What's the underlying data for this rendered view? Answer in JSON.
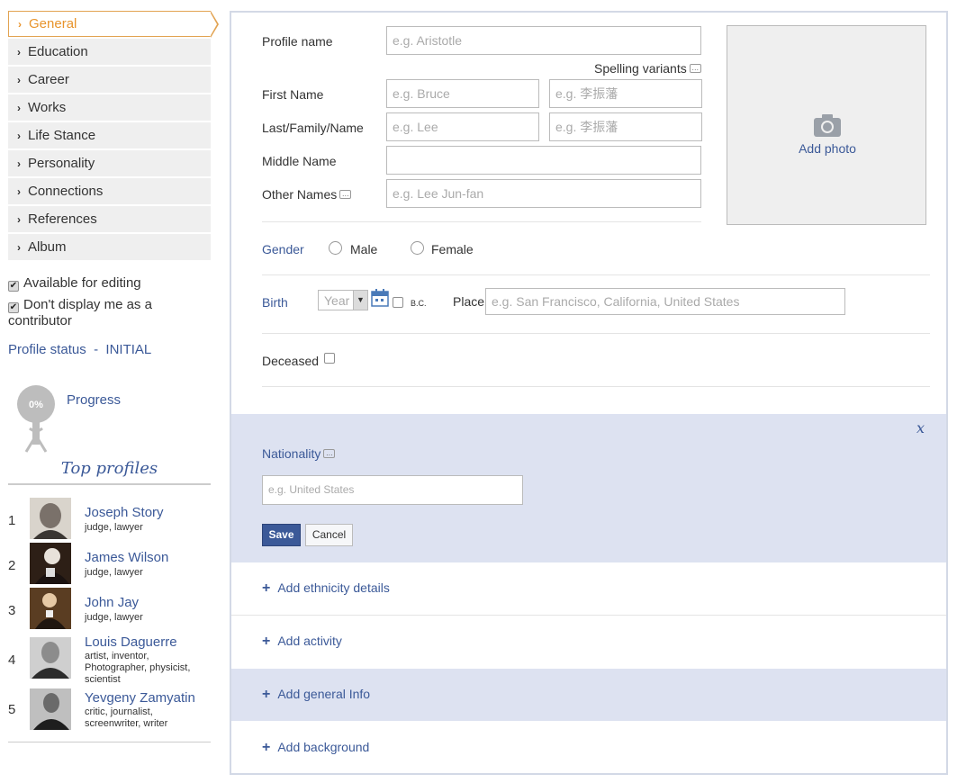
{
  "sidebar": {
    "items": [
      {
        "label": "General"
      },
      {
        "label": "Education"
      },
      {
        "label": "Career"
      },
      {
        "label": "Works"
      },
      {
        "label": "Life Stance"
      },
      {
        "label": "Personality"
      },
      {
        "label": "Connections"
      },
      {
        "label": "References"
      },
      {
        "label": "Album"
      }
    ],
    "available_for_editing": "Available for editing",
    "dont_display_line1": "Don't display me as a",
    "dont_display_line2": "contributor",
    "profile_status_label": "Profile status",
    "profile_status_sep": "-",
    "profile_status_value": "INITIAL",
    "progress_percent": "0%",
    "progress_label": "Progress",
    "top_profiles_title": "Top profiles",
    "top_profiles": [
      {
        "rank": "1",
        "name": "Joseph Story",
        "desc": "judge, lawyer"
      },
      {
        "rank": "2",
        "name": "James Wilson",
        "desc": "judge, lawyer"
      },
      {
        "rank": "3",
        "name": "John Jay",
        "desc": "judge, lawyer"
      },
      {
        "rank": "4",
        "name": "Louis Daguerre",
        "desc": "artist, inventor, Photographer, physicist, scientist"
      },
      {
        "rank": "5",
        "name": "Yevgeny Zamyatin",
        "desc": "critic, journalist, screenwriter, writer"
      }
    ]
  },
  "form": {
    "profile_name_label": "Profile name",
    "profile_name_placeholder": "e.g. Aristotle",
    "spelling_variants": "Spelling variants",
    "first_name_label": "First Name",
    "first_name_placeholder": "e.g. Bruce",
    "first_name_native_placeholder": "e.g. 李振藩",
    "last_name_label": "Last/Family/Name",
    "last_name_placeholder": "e.g. Lee",
    "last_name_native_placeholder": "e.g. 李振藩",
    "middle_name_label": "Middle Name",
    "middle_name_value": "",
    "other_names_label": "Other Names",
    "other_names_placeholder": "e.g. Lee Jun-fan",
    "add_photo": "Add photo",
    "gender_label": "Gender",
    "gender_male": "Male",
    "gender_female": "Female",
    "birth_label": "Birth",
    "birth_year_placeholder": "Year",
    "bc_label": "B.C.",
    "place_label": "Place",
    "place_placeholder": "e.g. San Francisco, California, United States",
    "deceased_label": "Deceased"
  },
  "nationality": {
    "close": "x",
    "label": "Nationality",
    "placeholder": "e.g. United States",
    "save": "Save",
    "cancel": "Cancel"
  },
  "sections": [
    {
      "label": "Add ethnicity details"
    },
    {
      "label": "Add activity"
    },
    {
      "label": "Add general Info"
    },
    {
      "label": "Add background"
    }
  ],
  "colors": {
    "accent_blue": "#3b5998",
    "active_orange": "#e8942c",
    "panel_shade": "#dde2f1"
  }
}
